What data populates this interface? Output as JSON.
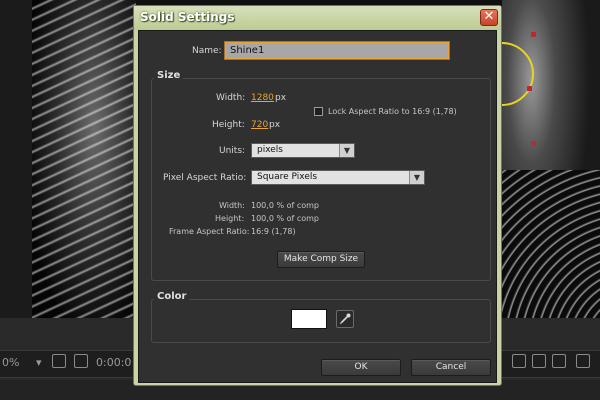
{
  "dialog": {
    "title": "Solid Settings",
    "close_glyph": "✕",
    "name_label": "Name:",
    "name_value": "Shine1",
    "size_group_title": "Size",
    "width_label": "Width:",
    "width_value": "1280",
    "width_unit": "px",
    "height_label": "Height:",
    "height_value": "720",
    "height_unit": "px",
    "lock_aspect_label": "Lock Aspect Ratio to 16:9 (1,78)",
    "lock_aspect_checked": false,
    "units_label": "Units:",
    "units_value": "pixels",
    "par_label": "Pixel Aspect Ratio:",
    "par_value": "Square Pixels",
    "info": {
      "width_label": "Width:",
      "width_value": "100,0 % of comp",
      "height_label": "Height:",
      "height_value": "100,0 % of comp",
      "far_label": "Frame Aspect Ratio:",
      "far_value": "16:9 (1,78)"
    },
    "make_comp_size_label": "Make Comp Size",
    "color_group_title": "Color",
    "color_value": "#FFFFFF",
    "ok_label": "OK",
    "cancel_label": "Cancel"
  },
  "timeline": {
    "zoom_text": "0%",
    "timecode_text": "0:00:0"
  },
  "colors": {
    "dialog_frame": "#c9d4a6",
    "panel_bg": "#303030",
    "accent_orange": "#e8a33a",
    "close_red": "#c8432a",
    "handle_red": "#c0282d",
    "path_yellow": "#e6d424"
  }
}
